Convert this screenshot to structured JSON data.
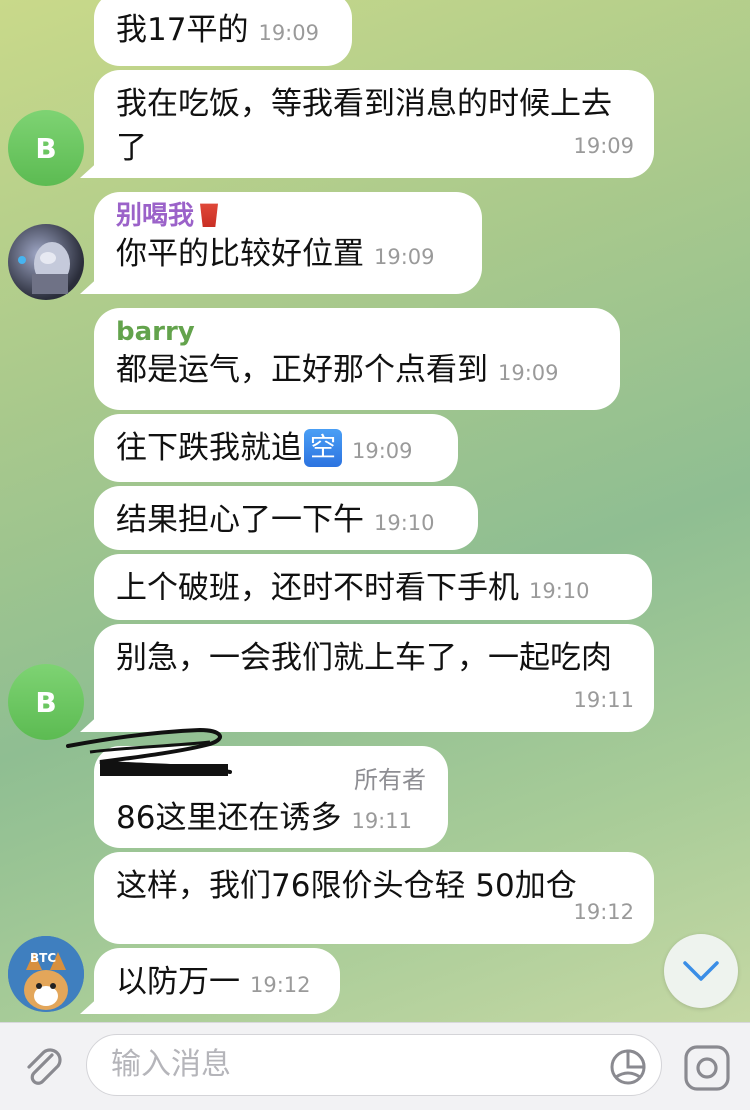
{
  "messages": [
    {
      "text": "我17平的",
      "time": "19:09"
    },
    {
      "text": "我在吃饭，等我看到消息的时候上去了",
      "time": "19:09",
      "avatar_letter": "B"
    },
    {
      "sender": "别喝我",
      "text": "你平的比较好位置",
      "time": "19:09"
    },
    {
      "sender": "barry",
      "text": "都是运气，正好那个点看到",
      "time": "19:09"
    },
    {
      "text": "往下跌我就追",
      "emoji": "空",
      "time": "19:09"
    },
    {
      "text": "结果担心了一下午",
      "time": "19:10"
    },
    {
      "text": "上个破班，还时不时看下手机",
      "time": "19:10"
    },
    {
      "text": "别急，一会我们就上车了，一起吃肉",
      "time": "19:11",
      "avatar_letter": "B"
    },
    {
      "role": "所有者",
      "text": "86这里还在诱多",
      "time": "19:11"
    },
    {
      "text": "这样，我们76限价头仓轻 50加仓",
      "time": "19:12"
    },
    {
      "text": "以防万一",
      "time": "19:12"
    }
  ],
  "input": {
    "placeholder": "输入消息"
  },
  "colors": {
    "accent_blue": "#3a8ee6",
    "avatar_green": "#63c05a",
    "sender_purple": "#9b62c9",
    "sender_green": "#63a34c"
  },
  "icons": [
    "attach-icon",
    "sticker-icon",
    "camera-icon",
    "chevron-down-icon",
    "cup-emoji-icon"
  ]
}
